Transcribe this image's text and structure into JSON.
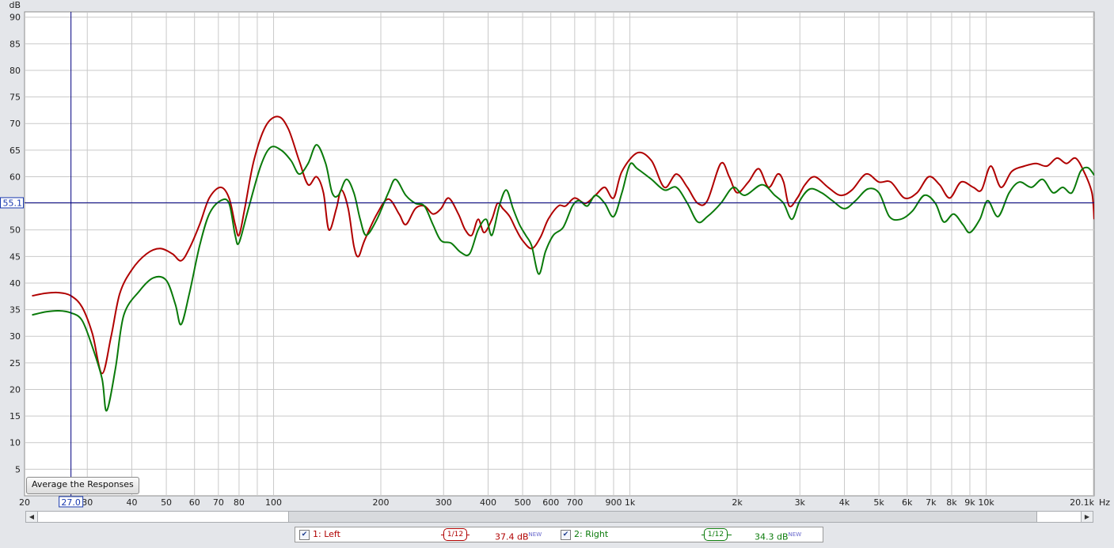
{
  "chart_data": {
    "type": "line",
    "ylabel": "dB",
    "xunit": "Hz",
    "x_scale": "log",
    "xlim": [
      20,
      20100
    ],
    "ylim": [
      0,
      91
    ],
    "yticks": [
      5,
      10,
      15,
      20,
      25,
      30,
      35,
      40,
      45,
      50,
      55,
      60,
      65,
      70,
      75,
      80,
      85,
      90
    ],
    "xticks": [
      {
        "v": 20,
        "label": "20"
      },
      {
        "v": 30,
        "label": "30"
      },
      {
        "v": 40,
        "label": "40"
      },
      {
        "v": 50,
        "label": "50"
      },
      {
        "v": 60,
        "label": "60"
      },
      {
        "v": 70,
        "label": "70"
      },
      {
        "v": 80,
        "label": "80"
      },
      {
        "v": 100,
        "label": "100"
      },
      {
        "v": 200,
        "label": "200"
      },
      {
        "v": 300,
        "label": "300"
      },
      {
        "v": 400,
        "label": "400"
      },
      {
        "v": 500,
        "label": "500"
      },
      {
        "v": 600,
        "label": "600"
      },
      {
        "v": 700,
        "label": "700"
      },
      {
        "v": 900,
        "label": "900"
      },
      {
        "v": 1000,
        "label": "1k"
      },
      {
        "v": 2000,
        "label": "2k"
      },
      {
        "v": 3000,
        "label": "3k"
      },
      {
        "v": 4000,
        "label": "4k"
      },
      {
        "v": 5000,
        "label": "5k"
      },
      {
        "v": 6000,
        "label": "6k"
      },
      {
        "v": 7000,
        "label": "7k"
      },
      {
        "v": 8000,
        "label": "8k"
      },
      {
        "v": 9000,
        "label": "9k"
      },
      {
        "v": 10000,
        "label": "10k"
      },
      {
        "v": 20100,
        "label": "20.1k"
      }
    ],
    "grid": true,
    "cursor": {
      "x": 27.0,
      "x_label": "27.0",
      "y": 55.1,
      "y_label": "55.1"
    },
    "series": [
      {
        "name": "1: Left",
        "color": "#b00000",
        "points": [
          [
            21,
            37.6
          ],
          [
            23,
            38.1
          ],
          [
            25,
            38.2
          ],
          [
            27,
            37.6
          ],
          [
            29,
            35.5
          ],
          [
            31,
            30.5
          ],
          [
            33,
            23
          ],
          [
            35,
            30
          ],
          [
            37,
            38
          ],
          [
            40,
            42.5
          ],
          [
            44,
            45.5
          ],
          [
            48,
            46.5
          ],
          [
            52,
            45.5
          ],
          [
            55,
            44.2
          ],
          [
            58,
            46.5
          ],
          [
            62,
            51
          ],
          [
            66,
            56
          ],
          [
            71,
            58
          ],
          [
            75,
            56
          ],
          [
            78,
            51
          ],
          [
            80,
            49
          ],
          [
            83,
            54
          ],
          [
            88,
            63
          ],
          [
            95,
            69.5
          ],
          [
            103,
            71.3
          ],
          [
            110,
            69
          ],
          [
            118,
            63
          ],
          [
            125,
            58.5
          ],
          [
            132,
            60
          ],
          [
            138,
            57
          ],
          [
            143,
            50
          ],
          [
            150,
            54
          ],
          [
            155,
            57.5
          ],
          [
            162,
            54
          ],
          [
            168,
            47
          ],
          [
            173,
            45
          ],
          [
            180,
            48
          ],
          [
            195,
            53
          ],
          [
            210,
            55.8
          ],
          [
            225,
            53
          ],
          [
            235,
            51
          ],
          [
            250,
            54
          ],
          [
            265,
            54.5
          ],
          [
            280,
            53
          ],
          [
            295,
            54
          ],
          [
            310,
            56
          ],
          [
            330,
            53
          ],
          [
            345,
            50
          ],
          [
            360,
            49
          ],
          [
            375,
            52
          ],
          [
            390,
            49.5
          ],
          [
            410,
            52
          ],
          [
            425,
            55
          ],
          [
            440,
            54
          ],
          [
            460,
            52.5
          ],
          [
            480,
            50
          ],
          [
            500,
            48
          ],
          [
            530,
            46.5
          ],
          [
            560,
            48.5
          ],
          [
            590,
            52
          ],
          [
            630,
            54.5
          ],
          [
            660,
            54.5
          ],
          [
            700,
            56
          ],
          [
            750,
            55
          ],
          [
            800,
            56.5
          ],
          [
            850,
            58
          ],
          [
            900,
            56
          ],
          [
            950,
            61
          ],
          [
            1050,
            64.5
          ],
          [
            1150,
            63
          ],
          [
            1250,
            58
          ],
          [
            1350,
            60.5
          ],
          [
            1450,
            58
          ],
          [
            1550,
            55
          ],
          [
            1650,
            55.5
          ],
          [
            1800,
            62.5
          ],
          [
            1900,
            60
          ],
          [
            2000,
            57
          ],
          [
            2150,
            59
          ],
          [
            2300,
            61.5
          ],
          [
            2450,
            58
          ],
          [
            2600,
            60.5
          ],
          [
            2700,
            59
          ],
          [
            2800,
            54.5
          ],
          [
            2950,
            56
          ],
          [
            3100,
            58.5
          ],
          [
            3300,
            60
          ],
          [
            3600,
            58
          ],
          [
            3900,
            56.5
          ],
          [
            4200,
            57.5
          ],
          [
            4600,
            60.5
          ],
          [
            5000,
            59
          ],
          [
            5400,
            59
          ],
          [
            5900,
            56
          ],
          [
            6400,
            57
          ],
          [
            6900,
            60
          ],
          [
            7400,
            58.5
          ],
          [
            7900,
            56
          ],
          [
            8500,
            59
          ],
          [
            9200,
            58
          ],
          [
            9700,
            57.5
          ],
          [
            10300,
            62
          ],
          [
            11000,
            58
          ],
          [
            11800,
            61
          ],
          [
            12800,
            62
          ],
          [
            13800,
            62.5
          ],
          [
            14800,
            62
          ],
          [
            15800,
            63.5
          ],
          [
            16800,
            62.5
          ],
          [
            17800,
            63.5
          ],
          [
            18800,
            61
          ],
          [
            19800,
            57
          ],
          [
            20100,
            52
          ]
        ]
      },
      {
        "name": "2: Right",
        "color": "#0a7a0a",
        "points": [
          [
            21,
            34
          ],
          [
            23,
            34.6
          ],
          [
            25,
            34.8
          ],
          [
            27,
            34.4
          ],
          [
            29,
            33
          ],
          [
            31,
            28
          ],
          [
            33,
            22
          ],
          [
            34,
            16
          ],
          [
            36,
            24
          ],
          [
            38,
            34
          ],
          [
            42,
            38.5
          ],
          [
            46,
            41
          ],
          [
            50,
            40.5
          ],
          [
            53,
            36
          ],
          [
            55,
            32.2
          ],
          [
            58,
            38
          ],
          [
            62,
            47
          ],
          [
            66,
            53
          ],
          [
            71,
            55.5
          ],
          [
            75,
            55
          ],
          [
            78,
            49
          ],
          [
            80,
            47.6
          ],
          [
            85,
            54
          ],
          [
            92,
            62
          ],
          [
            98,
            65.5
          ],
          [
            105,
            65
          ],
          [
            112,
            63
          ],
          [
            118,
            60.5
          ],
          [
            125,
            62.5
          ],
          [
            132,
            66
          ],
          [
            140,
            62.5
          ],
          [
            146,
            57
          ],
          [
            152,
            56.5
          ],
          [
            160,
            59.5
          ],
          [
            168,
            57
          ],
          [
            175,
            52
          ],
          [
            182,
            49
          ],
          [
            195,
            52
          ],
          [
            210,
            57
          ],
          [
            220,
            59.5
          ],
          [
            235,
            56.5
          ],
          [
            250,
            55
          ],
          [
            265,
            54.5
          ],
          [
            280,
            51
          ],
          [
            295,
            48
          ],
          [
            315,
            47.5
          ],
          [
            335,
            45.8
          ],
          [
            355,
            45.5
          ],
          [
            375,
            50
          ],
          [
            395,
            52
          ],
          [
            410,
            49
          ],
          [
            430,
            54.5
          ],
          [
            450,
            57.5
          ],
          [
            470,
            54
          ],
          [
            490,
            51
          ],
          [
            510,
            49
          ],
          [
            530,
            47
          ],
          [
            555,
            41.7
          ],
          [
            580,
            46
          ],
          [
            610,
            49
          ],
          [
            650,
            50.5
          ],
          [
            690,
            54.5
          ],
          [
            720,
            55.5
          ],
          [
            760,
            54.5
          ],
          [
            800,
            56.5
          ],
          [
            850,
            55
          ],
          [
            900,
            52.5
          ],
          [
            950,
            57
          ],
          [
            1000,
            62.3
          ],
          [
            1050,
            61.5
          ],
          [
            1150,
            59.5
          ],
          [
            1250,
            57.5
          ],
          [
            1350,
            58
          ],
          [
            1450,
            55
          ],
          [
            1550,
            51.5
          ],
          [
            1650,
            52.5
          ],
          [
            1800,
            55
          ],
          [
            1950,
            58
          ],
          [
            2100,
            56.5
          ],
          [
            2350,
            58.5
          ],
          [
            2550,
            56.5
          ],
          [
            2700,
            55
          ],
          [
            2850,
            52
          ],
          [
            3000,
            55.5
          ],
          [
            3200,
            57.7
          ],
          [
            3450,
            57
          ],
          [
            3700,
            55.5
          ],
          [
            4000,
            54
          ],
          [
            4300,
            55.5
          ],
          [
            4650,
            57.7
          ],
          [
            5000,
            57
          ],
          [
            5350,
            52.5
          ],
          [
            5750,
            52
          ],
          [
            6200,
            53.5
          ],
          [
            6700,
            56.5
          ],
          [
            7200,
            55
          ],
          [
            7600,
            51.5
          ],
          [
            8100,
            53
          ],
          [
            8600,
            51
          ],
          [
            9000,
            49.5
          ],
          [
            9600,
            52
          ],
          [
            10100,
            55.5
          ],
          [
            10800,
            52.5
          ],
          [
            11600,
            57
          ],
          [
            12400,
            59
          ],
          [
            13400,
            58
          ],
          [
            14400,
            59.5
          ],
          [
            15400,
            57
          ],
          [
            16400,
            58
          ],
          [
            17400,
            57
          ],
          [
            18400,
            61
          ],
          [
            19300,
            61.7
          ],
          [
            20100,
            60.3
          ]
        ]
      }
    ]
  },
  "ui": {
    "average_button": "Average the Responses",
    "legend": [
      {
        "checked": "✔",
        "label": "1: Left",
        "smoothing_num": "1",
        "smoothing_den": "12",
        "level": "37.4 dB",
        "tag": "NEW"
      },
      {
        "checked": "✔",
        "label": "2: Right",
        "smoothing_num": "1",
        "smoothing_den": "12",
        "level": "34.3 dB",
        "tag": "NEW"
      }
    ],
    "scroll_left": "◀",
    "scroll_right": "▶"
  }
}
